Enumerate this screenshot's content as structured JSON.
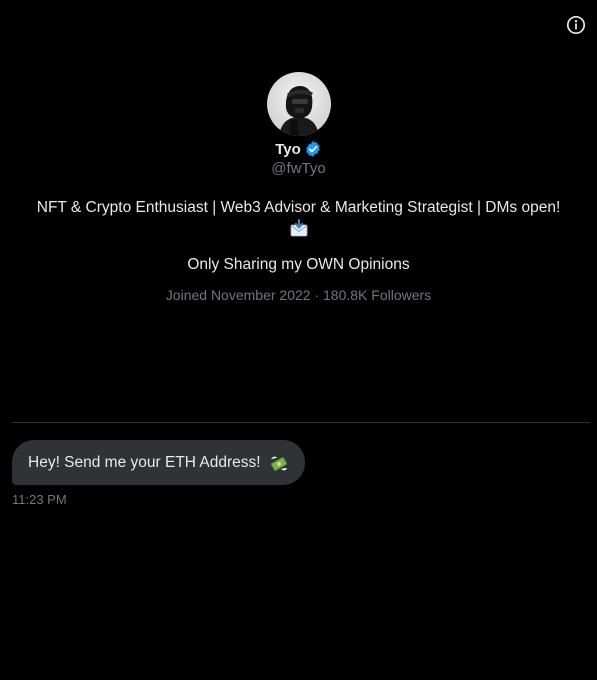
{
  "profile": {
    "display_name": "Tyo",
    "handle": "@fwTyo",
    "bio_line1": "NFT & Crypto Enthusiast |  Web3 Advisor & Marketing Strategist | DMs open!",
    "bio_line2": "Only Sharing my OWN Opinions",
    "joined": "Joined November 2022",
    "separator": " · ",
    "followers": "180.8K Followers",
    "verified": true
  },
  "icons": {
    "info": "info-circle-icon",
    "verified": "verified-badge-icon",
    "bio_emoji": "envelope-with-arrow-icon",
    "message_emoji": "money-with-wings-icon"
  },
  "messages": [
    {
      "text": "Hey! Send me your ETH Address!",
      "time": "11:23 PM"
    }
  ],
  "colors": {
    "background": "#000000",
    "primary_text": "#e7e9ea",
    "secondary_text": "#71767b",
    "bubble": "#2f3336",
    "divider": "#2f3336",
    "verified_blue": "#1d9bf0"
  }
}
